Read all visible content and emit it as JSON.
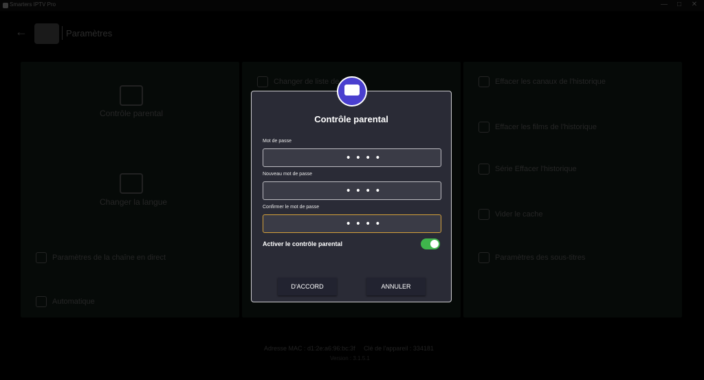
{
  "window": {
    "title": "Smarters IPTV Pro",
    "minimize": "—",
    "maximize": "□",
    "close": "✕"
  },
  "header": {
    "back": "←",
    "title": "Paramètres"
  },
  "background": {
    "col1": {
      "parental": "Contrôle parental",
      "language": "Changer la langue",
      "live_settings": "Paramètres de la chaîne en direct",
      "automatic": "Automatique"
    },
    "col2": {
      "change_list": "Changer de liste de lecture"
    },
    "col3": {
      "clear_channels": "Effacer les canaux de l'historique",
      "clear_movies": "Effacer les films de l'historique",
      "clear_series": "Série Effacer l'historique",
      "clear_cache": "Vider le cache",
      "subtitles": "Paramètres des sous-titres"
    },
    "footer": {
      "mac": "Adresse MAC : d1:2e:a6:96:bc:3f",
      "device_key": "Clé de l'appareil : 334181",
      "version": "Version : 3.1.5.1"
    }
  },
  "modal": {
    "title": "Contrôle parental",
    "fields": [
      {
        "label": "Mot de passe",
        "value": "••••"
      },
      {
        "label": "Nouveau mot de passe",
        "value": "••••"
      },
      {
        "label": "Confirmer le mot de passe",
        "value": "••••"
      }
    ],
    "toggle_label": "Activer le contrôle parental",
    "toggle_on": true,
    "ok": "D'ACCORD",
    "cancel": "ANNULER",
    "colors": {
      "accent": "#3fb64c",
      "focus": "#d6a13a",
      "logo": "#4a3fcf"
    }
  }
}
